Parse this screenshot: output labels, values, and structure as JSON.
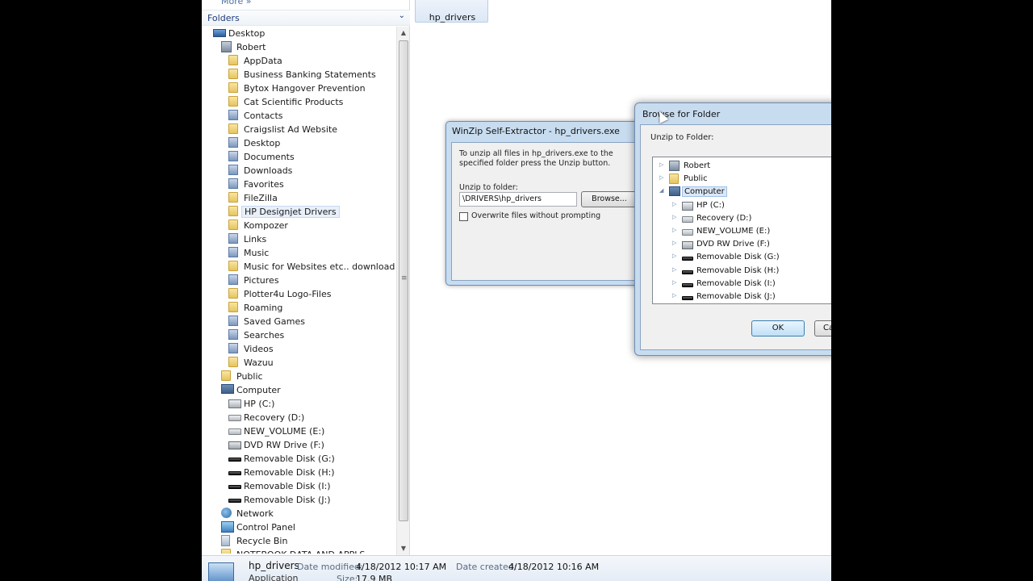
{
  "nav": {
    "more_label": "More »",
    "folders_title": "Folders",
    "tree": [
      {
        "label": "Desktop",
        "icon": "monitor",
        "indent": 0,
        "name": "desktop"
      },
      {
        "label": "Robert",
        "icon": "user",
        "indent": 1,
        "name": "robert"
      },
      {
        "label": "AppData",
        "icon": "folder",
        "indent": 2,
        "name": "appdata"
      },
      {
        "label": "Business Banking Statements",
        "icon": "folder",
        "indent": 2,
        "name": "business-banking-statements"
      },
      {
        "label": "Bytox Hangover Prevention",
        "icon": "folder",
        "indent": 2,
        "name": "bytox-hangover-prevention"
      },
      {
        "label": "Cat Scientific Products",
        "icon": "folder",
        "indent": 2,
        "name": "cat-scientific-products"
      },
      {
        "label": "Contacts",
        "icon": "folder-lib",
        "indent": 2,
        "name": "contacts"
      },
      {
        "label": "Craigslist Ad Website",
        "icon": "folder",
        "indent": 2,
        "name": "craigslist-ad-website"
      },
      {
        "label": "Desktop",
        "icon": "folder-lib",
        "indent": 2,
        "name": "desktop-folder"
      },
      {
        "label": "Documents",
        "icon": "folder-lib",
        "indent": 2,
        "name": "documents"
      },
      {
        "label": "Downloads",
        "icon": "folder-lib",
        "indent": 2,
        "name": "downloads"
      },
      {
        "label": "Favorites",
        "icon": "folder-lib",
        "indent": 2,
        "name": "favorites"
      },
      {
        "label": "FileZilla",
        "icon": "folder",
        "indent": 2,
        "name": "filezilla"
      },
      {
        "label": "HP Designjet Drivers",
        "icon": "folder",
        "indent": 2,
        "name": "hp-designjet-drivers",
        "selected": true
      },
      {
        "label": "Kompozer",
        "icon": "folder",
        "indent": 2,
        "name": "kompozer"
      },
      {
        "label": "Links",
        "icon": "folder-lib",
        "indent": 2,
        "name": "links"
      },
      {
        "label": "Music",
        "icon": "folder-lib",
        "indent": 2,
        "name": "music"
      },
      {
        "label": "Music for Websites etc.. downloaded",
        "icon": "folder",
        "indent": 2,
        "name": "music-for-websites"
      },
      {
        "label": "Pictures",
        "icon": "folder-lib",
        "indent": 2,
        "name": "pictures"
      },
      {
        "label": "Plotter4u Logo-Files",
        "icon": "folder",
        "indent": 2,
        "name": "plotter4u-logo-files"
      },
      {
        "label": "Roaming",
        "icon": "folder",
        "indent": 2,
        "name": "roaming"
      },
      {
        "label": "Saved Games",
        "icon": "folder-lib",
        "indent": 2,
        "name": "saved-games"
      },
      {
        "label": "Searches",
        "icon": "folder-lib",
        "indent": 2,
        "name": "searches"
      },
      {
        "label": "Videos",
        "icon": "folder-lib",
        "indent": 2,
        "name": "videos"
      },
      {
        "label": "Wazuu",
        "icon": "folder",
        "indent": 2,
        "name": "wazuu"
      },
      {
        "label": "Public",
        "icon": "folder",
        "indent": 1,
        "name": "public"
      },
      {
        "label": "Computer",
        "icon": "pc",
        "indent": 1,
        "name": "computer"
      },
      {
        "label": "HP (C:)",
        "icon": "drive-c",
        "indent": 2,
        "name": "drive-c"
      },
      {
        "label": "Recovery (D:)",
        "icon": "drive",
        "indent": 2,
        "name": "drive-d"
      },
      {
        "label": "NEW_VOLUME (E:)",
        "icon": "drive",
        "indent": 2,
        "name": "drive-e"
      },
      {
        "label": "DVD RW Drive (F:)",
        "icon": "dvd",
        "indent": 2,
        "name": "drive-f"
      },
      {
        "label": "Removable Disk (G:)",
        "icon": "usb",
        "indent": 2,
        "name": "drive-g"
      },
      {
        "label": "Removable Disk (H:)",
        "icon": "usb",
        "indent": 2,
        "name": "drive-h"
      },
      {
        "label": "Removable Disk (I:)",
        "icon": "usb",
        "indent": 2,
        "name": "drive-i"
      },
      {
        "label": "Removable Disk (J:)",
        "icon": "usb",
        "indent": 2,
        "name": "drive-j"
      },
      {
        "label": "Network",
        "icon": "network",
        "indent": 1,
        "name": "network"
      },
      {
        "label": "Control Panel",
        "icon": "cpanel",
        "indent": 1,
        "name": "control-panel"
      },
      {
        "label": "Recycle Bin",
        "icon": "recycle",
        "indent": 1,
        "name": "recycle-bin"
      },
      {
        "label": "NOTEBOOK DATA AND APPLS",
        "icon": "folder",
        "indent": 1,
        "name": "notebook-data"
      }
    ]
  },
  "content": {
    "file_tile_label": "hp_drivers"
  },
  "details": {
    "name": "hp_drivers",
    "type": "Application",
    "modified_label": "Date modified:",
    "modified_value": "4/18/2012 10:17 AM",
    "created_label": "Date created:",
    "created_value": "4/18/2012 10:16 AM",
    "size_label": "Size:",
    "size_value": "17.9 MB"
  },
  "winzip": {
    "title": "WinZip Self-Extractor - hp_drivers.exe",
    "description": "To unzip all files in hp_drivers.exe to the specified folder press the Unzip button.",
    "unzip_to_label": "Unzip to folder:",
    "path_value": "\\DRIVERS\\hp_drivers",
    "browse_label": "Browse...",
    "overwrite_label": "Overwrite files without prompting"
  },
  "browse": {
    "title": "Browse for Folder",
    "unzip_to_label": "Unzip to Folder:",
    "tree": [
      {
        "label": "Robert",
        "icon": "user",
        "level": 0,
        "expander": "▷",
        "name": "robert"
      },
      {
        "label": "Public",
        "icon": "folder",
        "level": 0,
        "expander": "▷",
        "name": "public"
      },
      {
        "label": "Computer",
        "icon": "pc",
        "level": 0,
        "expander": "◢",
        "name": "computer",
        "selected": true
      },
      {
        "label": "HP (C:)",
        "icon": "drive-c",
        "level": 1,
        "expander": "▷",
        "name": "drive-c"
      },
      {
        "label": "Recovery (D:)",
        "icon": "drive",
        "level": 1,
        "expander": "▷",
        "name": "drive-d"
      },
      {
        "label": "NEW_VOLUME (E:)",
        "icon": "drive",
        "level": 1,
        "expander": "▷",
        "name": "drive-e"
      },
      {
        "label": "DVD RW Drive (F:)",
        "icon": "dvd",
        "level": 1,
        "expander": "▷",
        "name": "drive-f"
      },
      {
        "label": "Removable Disk (G:)",
        "icon": "usb",
        "level": 1,
        "expander": "▷",
        "name": "drive-g"
      },
      {
        "label": "Removable Disk (H:)",
        "icon": "usb",
        "level": 1,
        "expander": "▷",
        "name": "drive-h"
      },
      {
        "label": "Removable Disk (I:)",
        "icon": "usb",
        "level": 1,
        "expander": "▷",
        "name": "drive-i"
      },
      {
        "label": "Removable Disk (J:)",
        "icon": "usb",
        "level": 1,
        "expander": "▷",
        "name": "drive-j"
      }
    ],
    "ok_label": "OK",
    "cancel_label": "Ca"
  }
}
